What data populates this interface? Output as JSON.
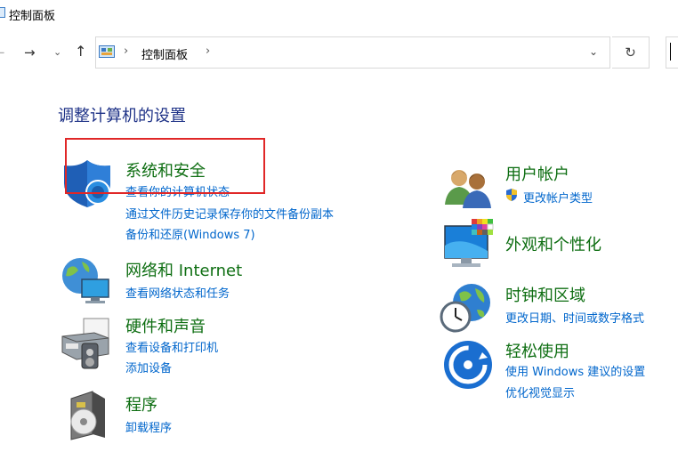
{
  "window": {
    "title": "控制面板"
  },
  "nav": {
    "back_glyph": "←",
    "forward_glyph": "→",
    "history_glyph": "⌄",
    "up_glyph": "↑",
    "breadcrumb_sep": "›",
    "breadcrumb": "控制面板",
    "dropdown_glyph": "⌄",
    "refresh_glyph": "↻"
  },
  "heading": "调整计算机的设置",
  "categories": [
    {
      "icon": "shield-icon",
      "title": "系统和安全",
      "links": [
        "查看你的计算机状态",
        "通过文件历史记录保存你的文件备份副本",
        "备份和还原(Windows 7)"
      ]
    },
    {
      "icon": "network-icon",
      "title": "网络和 Internet",
      "links": [
        "查看网络状态和任务"
      ]
    },
    {
      "icon": "printer-icon",
      "title": "硬件和声音",
      "links": [
        "查看设备和打印机",
        "添加设备"
      ]
    },
    {
      "icon": "programs-icon",
      "title": "程序",
      "links": [
        "卸载程序"
      ]
    },
    {
      "icon": "users-icon",
      "title": "用户帐户",
      "links": [
        "更改帐户类型"
      ]
    },
    {
      "icon": "appearance-icon",
      "title": "外观和个性化",
      "links": []
    },
    {
      "icon": "clock-globe-icon",
      "title": "时钟和区域",
      "links": [
        "更改日期、时间或数字格式"
      ]
    },
    {
      "icon": "ease-of-access-icon",
      "title": "轻松使用",
      "links": [
        "使用 Windows 建议的设置",
        "优化视觉显示"
      ]
    }
  ],
  "colors": {
    "heading": "#1e3287",
    "category_title": "#0e6e12",
    "link": "#0066cc",
    "highlight": "#e02727"
  }
}
